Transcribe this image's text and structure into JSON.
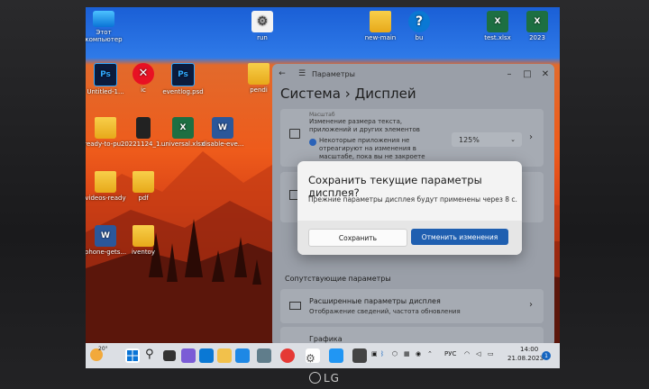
{
  "desktop": {
    "icons": [
      {
        "label": "Этот компьютер"
      },
      {
        "label": "run"
      },
      {
        "label": "new-main"
      },
      {
        "label": "bu"
      },
      {
        "label": "test.xlsx"
      },
      {
        "label": "2023"
      },
      {
        "label": "Untitled-1..."
      },
      {
        "label": "ic"
      },
      {
        "label": "eventlog.psd"
      },
      {
        "label": "pendi"
      },
      {
        "label": "ready-to-pu..."
      },
      {
        "label": "20221124_1..."
      },
      {
        "label": "universal.xlsx"
      },
      {
        "label": "disable-eve..."
      },
      {
        "label": "videos-ready"
      },
      {
        "label": "pdf"
      },
      {
        "label": "phone-gets..."
      },
      {
        "label": "iventoy"
      }
    ]
  },
  "settings_window": {
    "app_title": "Параметры",
    "breadcrumb_parent": "Система",
    "breadcrumb_sep": "›",
    "breadcrumb_current": "Дисплей",
    "scale_title": "Масштаб",
    "scale_desc": "Изменение размера текста, приложений и других элементов",
    "scale_warning": "Некоторые приложения не отреагируют на изменения в масштабе, пока вы не закроете их и",
    "scale_value": "125%",
    "related_header": "Сопутствующие параметры",
    "advanced_title": "Расширенные параметры дисплея",
    "advanced_desc": "Отображение сведений, частота обновления",
    "graphics_title": "Графика"
  },
  "dialog": {
    "title": "Сохранить текущие параметры дисплея?",
    "message": "Прежние параметры дисплея будут применены через  8 с.",
    "save_label": "Сохранить",
    "cancel_label": "Отменить изменения"
  },
  "taskbar": {
    "weather_temp": "20°",
    "language": "РУС",
    "time": "14:00",
    "date": "21.08.2023",
    "notification_count": "1"
  },
  "monitor": {
    "brand": "LG"
  }
}
